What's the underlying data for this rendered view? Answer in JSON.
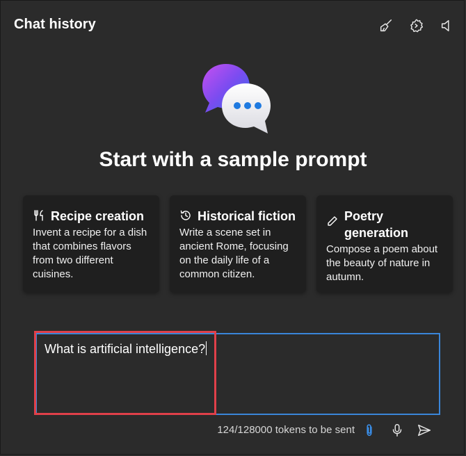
{
  "header": {
    "title": "Chat history",
    "icons": [
      "broom-icon",
      "gear-icon",
      "speaker-icon"
    ]
  },
  "hero": {
    "heading": "Start with a sample prompt"
  },
  "cards": [
    {
      "icon": "fork-knife-icon",
      "title": "Recipe creation",
      "description": "Invent a recipe for a dish that combines flavors from two different cuisines."
    },
    {
      "icon": "history-icon",
      "title": "Historical fiction",
      "description": "Write a scene set in ancient Rome, focusing on the daily life of a common citizen."
    },
    {
      "icon": "pen-icon",
      "title": "Poetry generation",
      "description": "Compose a poem about the beauty of nature in autumn."
    }
  ],
  "input": {
    "value": "What is artificial intelligence?"
  },
  "footer": {
    "tokens": "124/128000 tokens to be sent",
    "icons": [
      "paperclip-icon",
      "microphone-icon",
      "send-icon"
    ]
  },
  "colors": {
    "background": "#2b2b2b",
    "card": "#1f1f1f",
    "input_border": "#3a86d9",
    "highlight": "#e0404a",
    "accent_blue": "#1f7ae0"
  }
}
